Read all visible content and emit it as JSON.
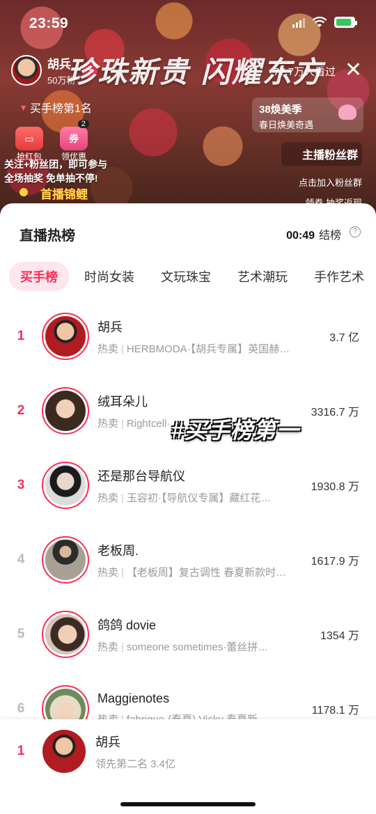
{
  "status_bar": {
    "time": "23:59"
  },
  "stream": {
    "anchor_name": "胡兵",
    "anchor_fans": "50万粉",
    "banner_title": "珍珠新贵 闪耀东方",
    "viewers": "77.7万人看过",
    "rank_badge": "买手榜第1名",
    "promo_title": "38焕美季",
    "promo_subtitle": "春日焕美奇遇",
    "chip_red_packet": "抢红包",
    "chip_coupon": "领优惠",
    "chip_coupon_icon": "券",
    "chip_coupon_count": "2",
    "lottery_line1": "关注+粉丝团，即可参与",
    "lottery_line2": "全场抽奖 免单抽不停!",
    "koi_text": "首播锦鲤",
    "fans_group_title": "主播粉丝群",
    "fans_group_join": "点击加入粉丝群",
    "fans_group_note": "领券 抽奖返现"
  },
  "sheet": {
    "title": "直播热榜",
    "timer": "00:49",
    "timer_label": "结榜",
    "help": "?",
    "tabs": [
      "买手榜",
      "时尚女装",
      "文玩珠宝",
      "艺术潮玩",
      "手作艺术"
    ],
    "hot_label": "热卖",
    "rows": [
      {
        "rank": "1",
        "name": "胡兵",
        "hot_item": "HERBMODA·【胡兵专属】英国赫…",
        "value": "3.7 亿"
      },
      {
        "rank": "2",
        "name": "绒耳朵儿",
        "hot_item": "Rightcell·…",
        "value": "3316.7 万"
      },
      {
        "rank": "3",
        "name": "还是那台导航仪",
        "hot_item": "玉容初·【导航仪专属】藏红花…",
        "value": "1930.8 万"
      },
      {
        "rank": "4",
        "name": "老板周.",
        "hot_item": "【老板周】复古调性 春夏新款时…",
        "value": "1617.9 万"
      },
      {
        "rank": "5",
        "name": "鸽鸽 dovie",
        "hot_item": "someone sometimes·蕾丝拼…",
        "value": "1354 万"
      },
      {
        "rank": "6",
        "name": "Maggienotes",
        "hot_item": "fabrique·(春夏) Vicky 春夏新…",
        "value": "1178.1 万"
      }
    ],
    "overlay_caption": "#买手榜第一",
    "self": {
      "rank": "1",
      "name": "胡兵",
      "lead": "领先第二名 3.4亿"
    }
  },
  "colors": {
    "accent": "#fe2c55",
    "tab_active_bg": "#fde7ec"
  }
}
